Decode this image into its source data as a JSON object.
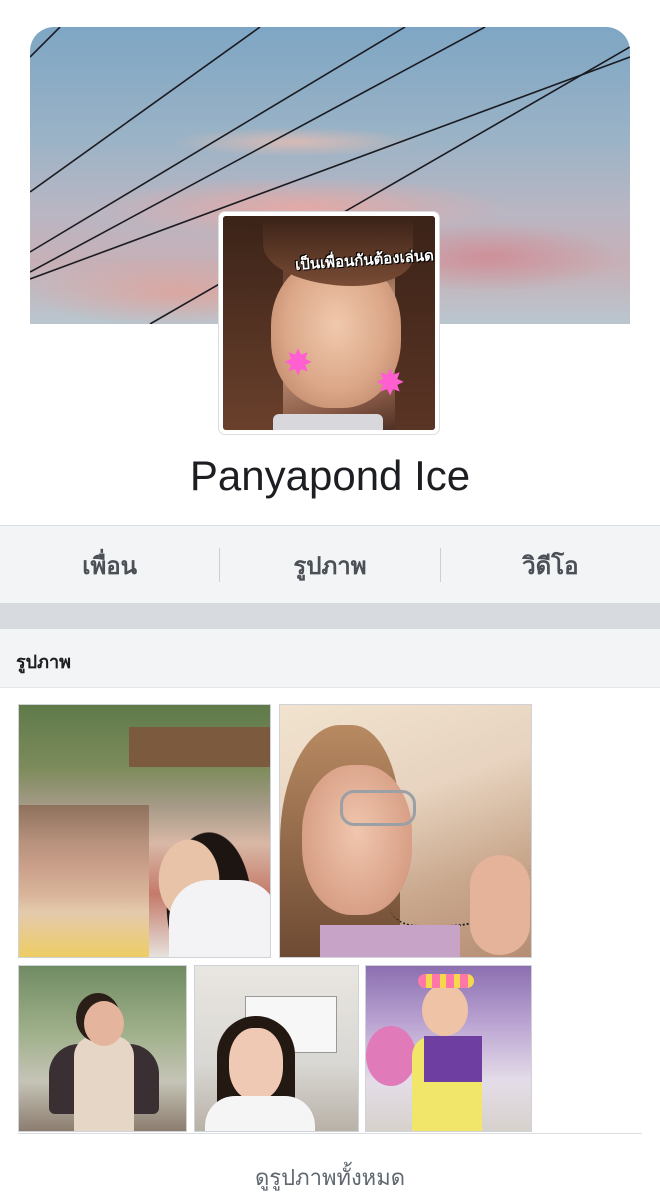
{
  "profile": {
    "name": "Panyapond Ice",
    "avatar_caption": "เป็นเพื่อนกันต้องเล่นด"
  },
  "nav": {
    "items": [
      {
        "label": "เพื่อน"
      },
      {
        "label": "รูปภาพ"
      },
      {
        "label": "วิดีโอ"
      }
    ]
  },
  "photos_section": {
    "title": "รูปภาพ",
    "see_all": "ดูรูปภาพทั้งหมด"
  },
  "colors": {
    "nav_background": "#f3f4f6",
    "text_primary": "#1c1e21",
    "text_secondary": "#4b4f56"
  }
}
